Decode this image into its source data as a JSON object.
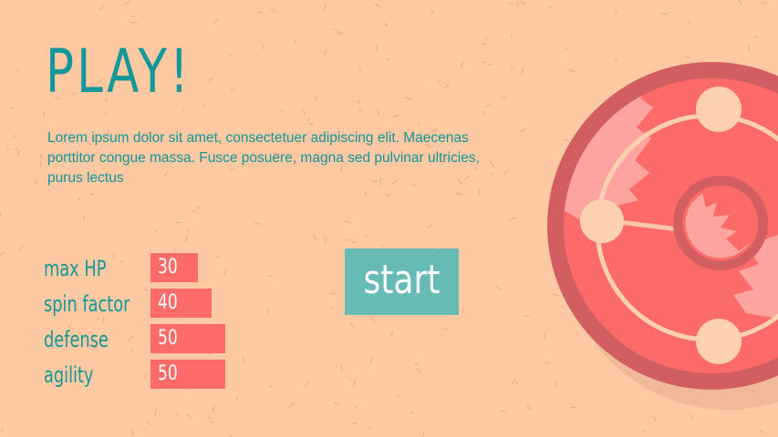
{
  "title": "PLAY!",
  "intro": "Lorem ipsum dolor sit amet, consectetuer adipiscing elit. Maecenas porttitor congue massa. Fusce posuere, magna sed pulvinar ultricies, purus lectus",
  "stats": [
    {
      "label": "max HP",
      "value": "30"
    },
    {
      "label": "spin factor",
      "value": "40"
    },
    {
      "label": "defense",
      "value": "50"
    },
    {
      "label": "agility",
      "value": "50"
    }
  ],
  "start_button": {
    "label": "start"
  },
  "icons": {
    "spinner": "spinning-top-icon",
    "background": "speckle-texture"
  },
  "colors": {
    "background": "#fdc9a3",
    "teal_text": "#15979a",
    "bar": "#fd6b68",
    "button": "#66bbb4",
    "spinner_body": "#fd6b68",
    "spinner_rim": "#d35e61",
    "spinner_line": "#fdd0b0"
  }
}
